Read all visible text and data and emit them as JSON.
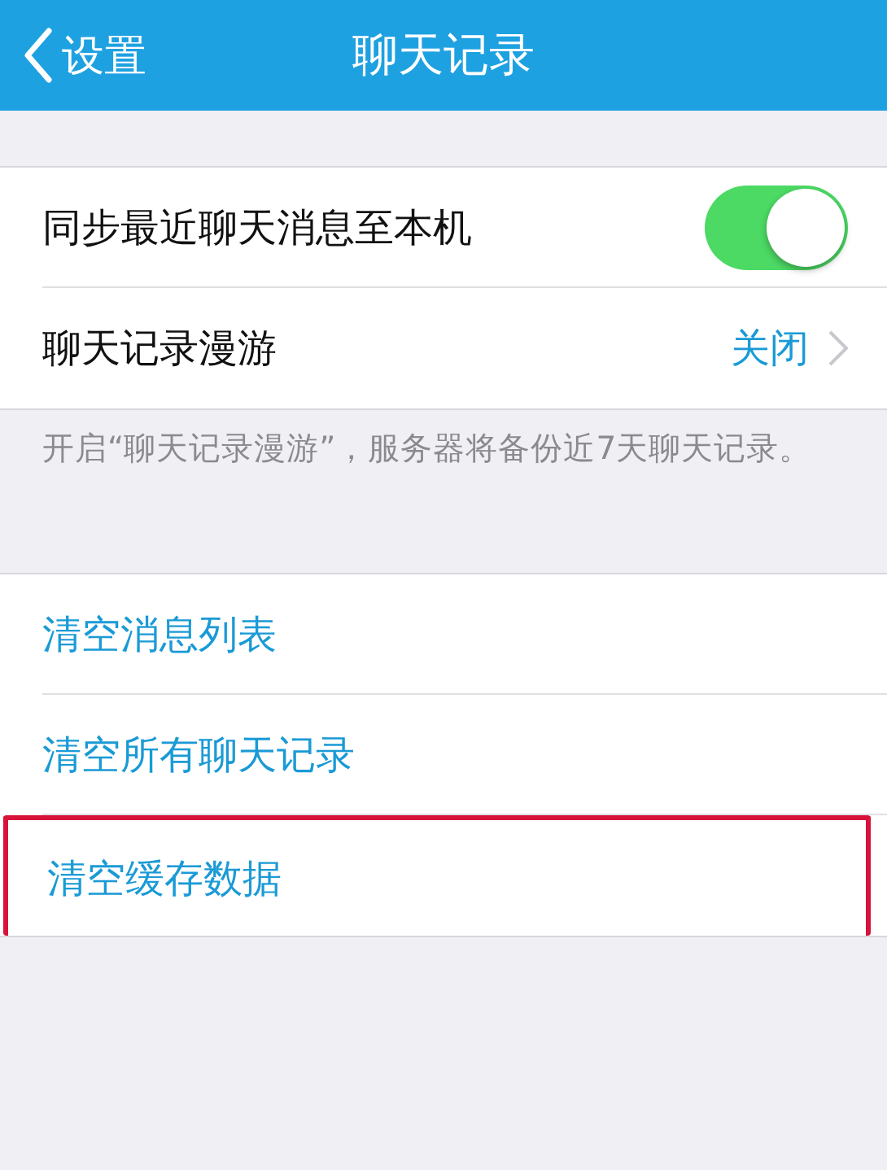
{
  "nav_bar": {
    "back_label": "设置",
    "title": "聊天记录"
  },
  "settings": [
    {
      "kind": "toggle",
      "label": "同步最近聊天消息至本机",
      "on": true
    },
    {
      "kind": "link",
      "label": "聊天记录漫游",
      "value": "关闭"
    }
  ],
  "note": "开启“聊天记录漫游”，服务器将备份近7天聊天记录。",
  "actions": [
    {
      "label": "清空消息列表",
      "highlighted": false
    },
    {
      "label": "清空所有聊天记录",
      "highlighted": false
    },
    {
      "label": "清空缓存数据",
      "highlighted": true
    }
  ]
}
